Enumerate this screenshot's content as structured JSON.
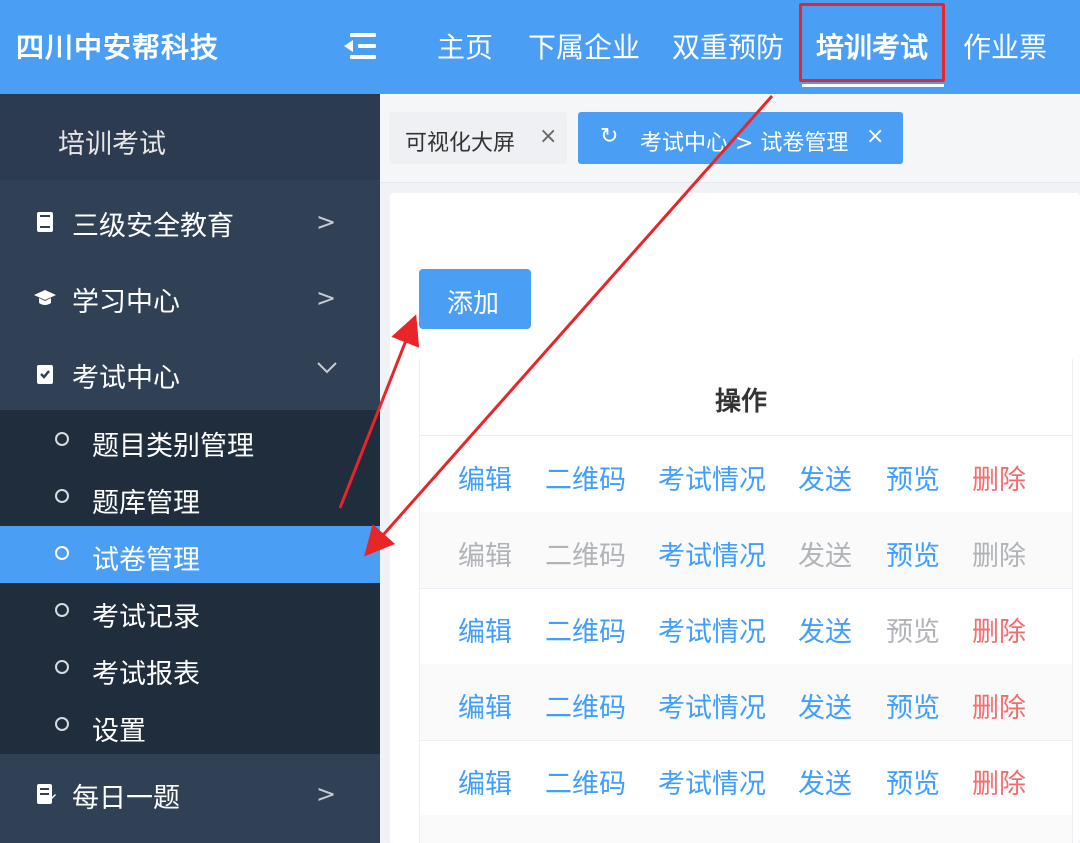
{
  "header": {
    "brand": "四川中安帮科技",
    "nav": [
      "主页",
      "下属企业",
      "双重预防",
      "培训考试",
      "作业票"
    ],
    "active_nav": "培训考试"
  },
  "sidebar": {
    "title": "培训考试",
    "items": [
      {
        "label": "三级安全教育",
        "icon": "book-icon",
        "expanded": false
      },
      {
        "label": "学习中心",
        "icon": "graduation-cap-icon",
        "expanded": false
      },
      {
        "label": "考试中心",
        "icon": "exam-clipboard-icon",
        "expanded": true
      },
      {
        "label": "每日一题",
        "icon": "notebook-icon",
        "expanded": false
      }
    ],
    "exam_submenu": [
      "题目类别管理",
      "题库管理",
      "试卷管理",
      "考试记录",
      "考试报表",
      "设置"
    ],
    "active_sub": "试卷管理"
  },
  "tags": [
    {
      "label": "可视化大屏",
      "close": "×"
    },
    {
      "label": "考试中心 > 试卷管理",
      "close": "×",
      "refresh": "↻",
      "active": true
    }
  ],
  "main": {
    "add_label": "添加",
    "table": {
      "header": "操作",
      "rows": [
        {
          "actions": [
            "编辑",
            "二维码",
            "考试情况",
            "发送",
            "预览",
            "删除"
          ],
          "states": [
            "blue",
            "blue",
            "blue",
            "blue",
            "blue",
            "red"
          ]
        },
        {
          "actions": [
            "编辑",
            "二维码",
            "考试情况",
            "发送",
            "预览",
            "删除"
          ],
          "states": [
            "gray",
            "gray",
            "blue",
            "gray",
            "blue",
            "gray"
          ]
        },
        {
          "actions": [
            "编辑",
            "二维码",
            "考试情况",
            "发送",
            "预览",
            "删除"
          ],
          "states": [
            "blue",
            "blue",
            "blue",
            "blue",
            "gray",
            "red"
          ]
        },
        {
          "actions": [
            "编辑",
            "二维码",
            "考试情况",
            "发送",
            "预览",
            "删除"
          ],
          "states": [
            "blue",
            "blue",
            "blue",
            "blue",
            "blue",
            "red"
          ]
        },
        {
          "actions": [
            "编辑",
            "二维码",
            "考试情况",
            "发送",
            "预览",
            "删除"
          ],
          "states": [
            "blue",
            "blue",
            "blue",
            "blue",
            "blue",
            "red"
          ]
        }
      ]
    }
  },
  "colors": {
    "primary": "#4a9ff5",
    "sidebar": "#304156",
    "submenu": "#1f2d3d",
    "danger": "#f56c6c",
    "annotation": "#e8262a"
  }
}
